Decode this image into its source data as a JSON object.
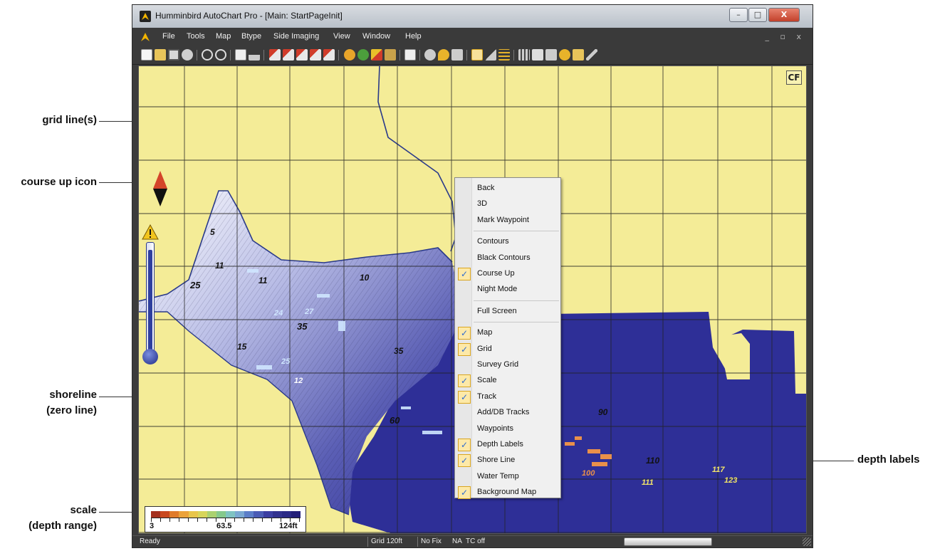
{
  "window": {
    "title": "Humminbird AutoChart Pro - [Main: StartPageInit]",
    "minimize": "–",
    "maximize": "□",
    "close": "X",
    "mdi_controls": "_ ▫ x"
  },
  "menu": [
    "File",
    "Tools",
    "Map",
    "Btype",
    "Side Imaging",
    "View",
    "Window",
    "Help"
  ],
  "callouts": {
    "grid_lines": "grid line(s)",
    "course_up": "course up icon",
    "shoreline_1": "shoreline",
    "shoreline_2": "(zero line)",
    "depth_labels": "depth labels",
    "scale_1": "scale",
    "scale_2": "(depth range)"
  },
  "map": {
    "warning_icon": "warning-icon",
    "compass_icon": "course-up-icon",
    "cf_icon": "CF",
    "depth_label_values": [
      "5",
      "11",
      "25",
      "11",
      "10",
      "24",
      "27",
      "35",
      "15",
      "25",
      "12",
      "35",
      "60",
      "90",
      "110",
      "111",
      "123",
      "117",
      "100"
    ],
    "colors": {
      "land": "#f4ec97",
      "deep_water": "#2e2f97",
      "shoreline": "#2a3a8a"
    }
  },
  "scale": {
    "min": "3",
    "mid": "63.5",
    "max": "124ft",
    "colors": [
      "#a4301e",
      "#c9481f",
      "#e07b2a",
      "#eba23a",
      "#e8c54a",
      "#d7d55a",
      "#aad170",
      "#85c98c",
      "#7fc3c2",
      "#7aa8d2",
      "#5c7ec8",
      "#4b5cb5",
      "#3c3fa2",
      "#32328f",
      "#2b2a86",
      "#231f78"
    ]
  },
  "context_menu": {
    "items": [
      {
        "label": "Back",
        "checked": false
      },
      {
        "label": "3D",
        "checked": false
      },
      {
        "label": "Mark Waypoint",
        "checked": false
      },
      {
        "label": "Contours",
        "checked": false
      },
      {
        "label": "Black Contours",
        "checked": false
      },
      {
        "label": "Course Up",
        "checked": true
      },
      {
        "label": "Night Mode",
        "checked": false
      },
      {
        "label": "Full Screen",
        "checked": false
      },
      {
        "label": "Map",
        "checked": true
      },
      {
        "label": "Grid",
        "checked": true
      },
      {
        "label": "Survey Grid",
        "checked": false
      },
      {
        "label": "Scale",
        "checked": true
      },
      {
        "label": "Track",
        "checked": true
      },
      {
        "label": "Add/DB Tracks",
        "checked": false
      },
      {
        "label": "Waypoints",
        "checked": false
      },
      {
        "label": "Depth Labels",
        "checked": true
      },
      {
        "label": "Shore Line",
        "checked": true
      },
      {
        "label": "Water Temp",
        "checked": false
      },
      {
        "label": "Background Map",
        "checked": true
      }
    ],
    "check_glyph": "✓"
  },
  "status": {
    "ready": "Ready",
    "grid": "Grid 120ft",
    "fix": "No Fix",
    "na": "NA",
    "tc": "TC off"
  }
}
